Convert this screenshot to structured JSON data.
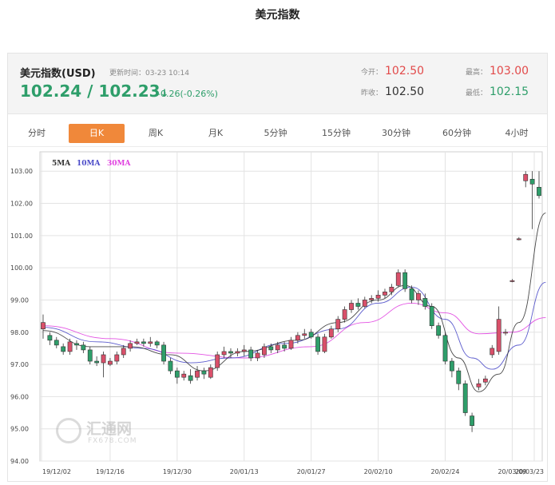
{
  "title": "美元指数",
  "quote": {
    "name": "美元指数(USD)",
    "updated_label": "更新时间：",
    "updated_time": "03-23 10:14",
    "price": "102.24 / 102.23",
    "arrow": "↓",
    "change": "-0.26(-0.26%)",
    "open_label": "今开：",
    "open": "102.50",
    "high_label": "最高：",
    "high": "103.00",
    "prev_label": "昨收：",
    "prev": "102.50",
    "low_label": "最低：",
    "low": "102.15"
  },
  "tabs": [
    "分时",
    "日K",
    "周K",
    "月K",
    "5分钟",
    "15分钟",
    "30分钟",
    "60分钟",
    "4小时"
  ],
  "active_tab": "日K",
  "watermark": {
    "text1": "汇通网",
    "text2": "FX678.COM"
  },
  "chart_data": {
    "type": "candlestick",
    "ylim": [
      94,
      103.6
    ],
    "yticks": [
      "94.00",
      "95.00",
      "96.00",
      "97.00",
      "98.00",
      "99.00",
      "100.00",
      "101.00",
      "102.00",
      "103.00"
    ],
    "xticks": [
      "19/12/02",
      "19/12/16",
      "19/12/30",
      "20/01/13",
      "20/01/27",
      "20/02/10",
      "20/02/24",
      "20/03/09",
      "20/03/23"
    ],
    "grid": true,
    "legend_position": "top-left",
    "legend": [
      {
        "name": "5MA",
        "color": "#333333"
      },
      {
        "name": "10MA",
        "color": "#4a4ac8"
      },
      {
        "name": "30MA",
        "color": "#e040e0"
      }
    ],
    "colors": {
      "up": "#d9506a",
      "down": "#2e9e6a"
    },
    "candles": [
      [
        98.1,
        98.3,
        97.8,
        98.55
      ],
      [
        97.9,
        97.75,
        97.6,
        98.0
      ],
      [
        97.75,
        97.6,
        97.5,
        97.85
      ],
      [
        97.55,
        97.4,
        97.3,
        97.65
      ],
      [
        97.4,
        97.7,
        97.3,
        97.8
      ],
      [
        97.65,
        97.6,
        97.45,
        97.75
      ],
      [
        97.6,
        97.45,
        97.35,
        97.7
      ],
      [
        97.45,
        97.1,
        97.0,
        97.55
      ],
      [
        97.1,
        97.05,
        96.95,
        97.25
      ],
      [
        97.05,
        97.3,
        96.6,
        97.4
      ],
      [
        97.0,
        97.1,
        96.95,
        97.2
      ],
      [
        97.1,
        97.3,
        97.0,
        97.4
      ],
      [
        97.3,
        97.5,
        97.2,
        97.6
      ],
      [
        97.5,
        97.65,
        97.4,
        97.75
      ],
      [
        97.65,
        97.7,
        97.6,
        97.8
      ],
      [
        97.7,
        97.65,
        97.55,
        97.8
      ],
      [
        97.65,
        97.7,
        97.55,
        97.85
      ],
      [
        97.7,
        97.6,
        97.5,
        97.75
      ],
      [
        97.6,
        97.1,
        97.0,
        97.7
      ],
      [
        97.1,
        96.8,
        96.7,
        97.2
      ],
      [
        96.8,
        96.6,
        96.4,
        96.9
      ],
      [
        96.6,
        96.7,
        96.5,
        96.8
      ],
      [
        96.65,
        96.5,
        96.4,
        96.85
      ],
      [
        96.6,
        96.8,
        96.5,
        96.95
      ],
      [
        96.8,
        96.7,
        96.55,
        96.9
      ],
      [
        96.6,
        96.9,
        96.55,
        97.0
      ],
      [
        96.9,
        97.3,
        96.8,
        97.4
      ],
      [
        97.3,
        97.4,
        97.2,
        97.55
      ],
      [
        97.4,
        97.35,
        97.2,
        97.5
      ],
      [
        97.35,
        97.4,
        97.25,
        97.5
      ],
      [
        97.4,
        97.45,
        97.25,
        97.6
      ],
      [
        97.45,
        97.2,
        97.1,
        97.55
      ],
      [
        97.2,
        97.35,
        97.1,
        97.45
      ],
      [
        97.3,
        97.55,
        97.2,
        97.65
      ],
      [
        97.55,
        97.45,
        97.35,
        97.65
      ],
      [
        97.45,
        97.6,
        97.35,
        97.7
      ],
      [
        97.6,
        97.5,
        97.4,
        97.7
      ],
      [
        97.5,
        97.75,
        97.45,
        97.85
      ],
      [
        97.75,
        97.9,
        97.65,
        98.0
      ],
      [
        97.9,
        97.95,
        97.8,
        98.1
      ],
      [
        98.0,
        97.85,
        97.8,
        98.1
      ],
      [
        97.85,
        97.4,
        97.3,
        97.95
      ],
      [
        97.4,
        97.85,
        97.35,
        97.95
      ],
      [
        97.85,
        98.1,
        97.8,
        98.2
      ],
      [
        98.1,
        98.4,
        98.0,
        98.5
      ],
      [
        98.4,
        98.7,
        98.3,
        98.8
      ],
      [
        98.7,
        98.9,
        98.6,
        99.0
      ],
      [
        98.9,
        98.8,
        98.7,
        99.05
      ],
      [
        98.8,
        99.0,
        98.75,
        99.1
      ],
      [
        99.0,
        99.05,
        98.9,
        99.15
      ],
      [
        99.05,
        99.15,
        98.95,
        99.3
      ],
      [
        99.15,
        99.25,
        99.05,
        99.35
      ],
      [
        99.25,
        99.4,
        99.15,
        99.5
      ],
      [
        99.45,
        99.85,
        99.4,
        99.95
      ],
      [
        99.85,
        99.35,
        99.25,
        99.95
      ],
      [
        99.35,
        99.0,
        98.9,
        99.45
      ],
      [
        99.0,
        99.2,
        98.85,
        99.3
      ],
      [
        99.05,
        98.8,
        98.7,
        99.2
      ],
      [
        98.8,
        98.2,
        98.1,
        98.9
      ],
      [
        98.2,
        97.9,
        97.8,
        98.3
      ],
      [
        97.9,
        97.1,
        97.0,
        98.0
      ],
      [
        97.1,
        96.8,
        96.6,
        97.2
      ],
      [
        96.8,
        96.4,
        96.2,
        96.9
      ],
      [
        96.4,
        95.5,
        95.4,
        96.5
      ],
      [
        95.4,
        95.1,
        94.9,
        95.5
      ],
      [
        96.3,
        96.4,
        96.2,
        96.55
      ],
      [
        96.45,
        96.55,
        96.35,
        96.65
      ],
      [
        97.3,
        97.5,
        97.2,
        97.6
      ],
      [
        97.4,
        98.4,
        97.3,
        98.8
      ],
      [
        98.0,
        98.0,
        97.9,
        98.1
      ],
      [
        99.6,
        99.6,
        99.55,
        99.65
      ],
      [
        100.9,
        100.9,
        100.85,
        100.95
      ],
      [
        102.7,
        102.9,
        102.5,
        103.0
      ],
      [
        102.75,
        102.6,
        101.2,
        103.0
      ],
      [
        102.5,
        102.24,
        102.15,
        103.0
      ]
    ],
    "ma5": [
      [
        0,
        98.05
      ],
      [
        7,
        97.55
      ],
      [
        13,
        97.55
      ],
      [
        19,
        97.3
      ],
      [
        24,
        96.8
      ],
      [
        30,
        97.4
      ],
      [
        38,
        97.75
      ],
      [
        44,
        98.3
      ],
      [
        50,
        99.0
      ],
      [
        54,
        99.45
      ],
      [
        58,
        98.8
      ],
      [
        62,
        97.2
      ],
      [
        65,
        96.15
      ],
      [
        68,
        96.7
      ],
      [
        71,
        98.3
      ],
      [
        75,
        101.7
      ]
    ],
    "ma10": [
      [
        0,
        98.15
      ],
      [
        8,
        97.7
      ],
      [
        15,
        97.5
      ],
      [
        22,
        97.05
      ],
      [
        28,
        97.2
      ],
      [
        36,
        97.65
      ],
      [
        44,
        98.1
      ],
      [
        50,
        98.9
      ],
      [
        55,
        99.4
      ],
      [
        60,
        98.4
      ],
      [
        64,
        97.2
      ],
      [
        67,
        96.85
      ],
      [
        71,
        97.6
      ],
      [
        75,
        99.55
      ]
    ],
    "ma30": [
      [
        0,
        98.2
      ],
      [
        10,
        97.8
      ],
      [
        20,
        97.35
      ],
      [
        30,
        97.2
      ],
      [
        40,
        97.55
      ],
      [
        48,
        98.3
      ],
      [
        55,
        98.9
      ],
      [
        60,
        98.6
      ],
      [
        65,
        97.95
      ],
      [
        70,
        98.0
      ],
      [
        75,
        98.45
      ]
    ]
  }
}
